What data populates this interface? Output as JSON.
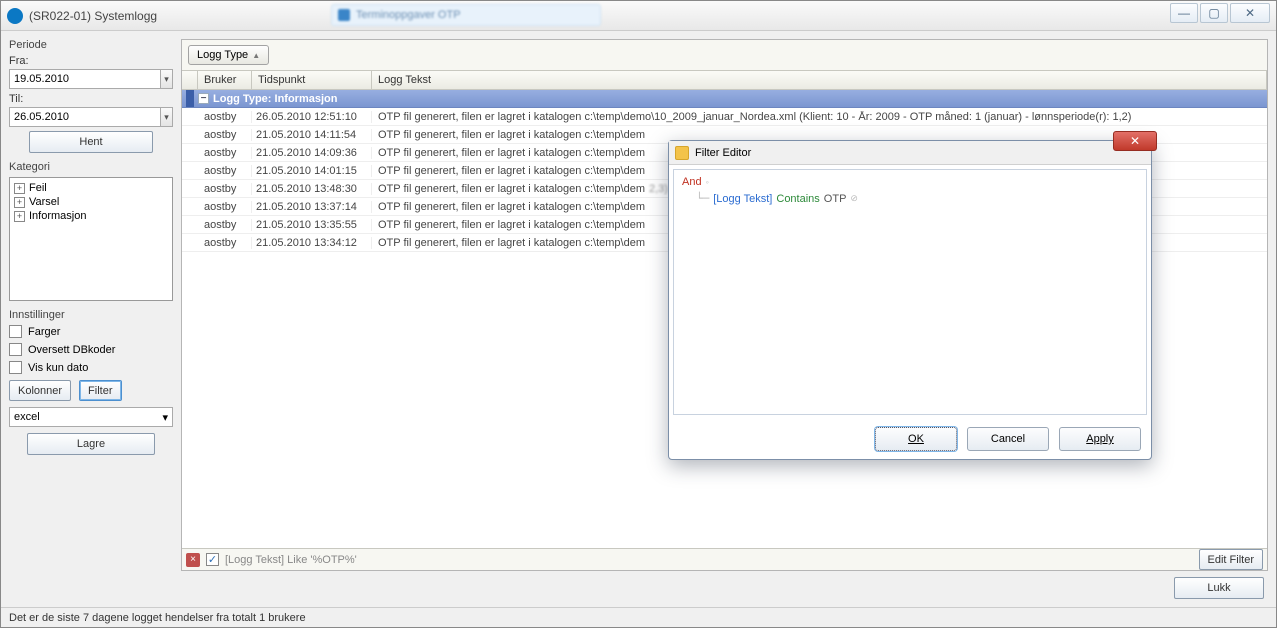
{
  "window": {
    "title": "(SR022-01) Systemlogg",
    "bg_tab_text": "Terminoppgaver OTP"
  },
  "sidebar": {
    "periode": {
      "title": "Periode",
      "fra_label": "Fra:",
      "fra_value": "19.05.2010",
      "til_label": "Til:",
      "til_value": "26.05.2010",
      "hent_label": "Hent"
    },
    "kategori": {
      "title": "Kategori",
      "items": [
        "Feil",
        "Varsel",
        "Informasjon"
      ]
    },
    "innstillinger": {
      "title": "Innstillinger",
      "farger": "Farger",
      "oversett": "Oversett DBkoder",
      "viskun": "Vis kun dato",
      "kolonner_btn": "Kolonner",
      "filter_btn": "Filter",
      "export_value": "excel",
      "lagre_btn": "Lagre"
    }
  },
  "grid": {
    "group_chip": "Logg Type",
    "columns": {
      "bruker": "Bruker",
      "tidspunkt": "Tidspunkt",
      "loggtekst": "Logg Tekst"
    },
    "group_header": "Logg Type: Informasjon",
    "rows": [
      {
        "bruker": "aostby",
        "tid": "26.05.2010 12:51:10",
        "text": "OTP fil generert, filen er lagret i katalogen c:\\temp\\demo\\10_2009_januar_Nordea.xml  (Klient: 10 - År: 2009 - OTP måned: 1 (januar) - lønnsperiode(r): 1,2)"
      },
      {
        "bruker": "aostby",
        "tid": "21.05.2010 14:11:54",
        "text": "OTP fil generert, filen er lagret i katalogen c:\\temp\\dem"
      },
      {
        "bruker": "aostby",
        "tid": "21.05.2010 14:09:36",
        "text": "OTP fil generert, filen er lagret i katalogen c:\\temp\\dem"
      },
      {
        "bruker": "aostby",
        "tid": "21.05.2010 14:01:15",
        "text": "OTP fil generert, filen er lagret i katalogen c:\\temp\\dem"
      },
      {
        "bruker": "aostby",
        "tid": "21.05.2010 13:48:30",
        "text": "OTP fil generert, filen er lagret i katalogen c:\\temp\\dem",
        "tail": "2,3)"
      },
      {
        "bruker": "aostby",
        "tid": "21.05.2010 13:37:14",
        "text": "OTP fil generert, filen er lagret i katalogen c:\\temp\\dem"
      },
      {
        "bruker": "aostby",
        "tid": "21.05.2010 13:35:55",
        "text": "OTP fil generert, filen er lagret i katalogen c:\\temp\\dem"
      },
      {
        "bruker": "aostby",
        "tid": "21.05.2010 13:34:12",
        "text": "OTP fil generert, filen er lagret i katalogen c:\\temp\\dem"
      }
    ],
    "footer_filter": "[Logg Tekst] Like '%OTP%'",
    "edit_filter": "Edit Filter"
  },
  "bottom": {
    "lukk": "Lukk"
  },
  "status": "Det er de siste 7 dagene logget hendelser fra totalt 1 brukere",
  "dialog": {
    "title": "Filter Editor",
    "root_op": "And",
    "field": "[Logg Tekst]",
    "operator": "Contains",
    "value": "OTP",
    "ok": "OK",
    "cancel": "Cancel",
    "apply": "Apply"
  }
}
